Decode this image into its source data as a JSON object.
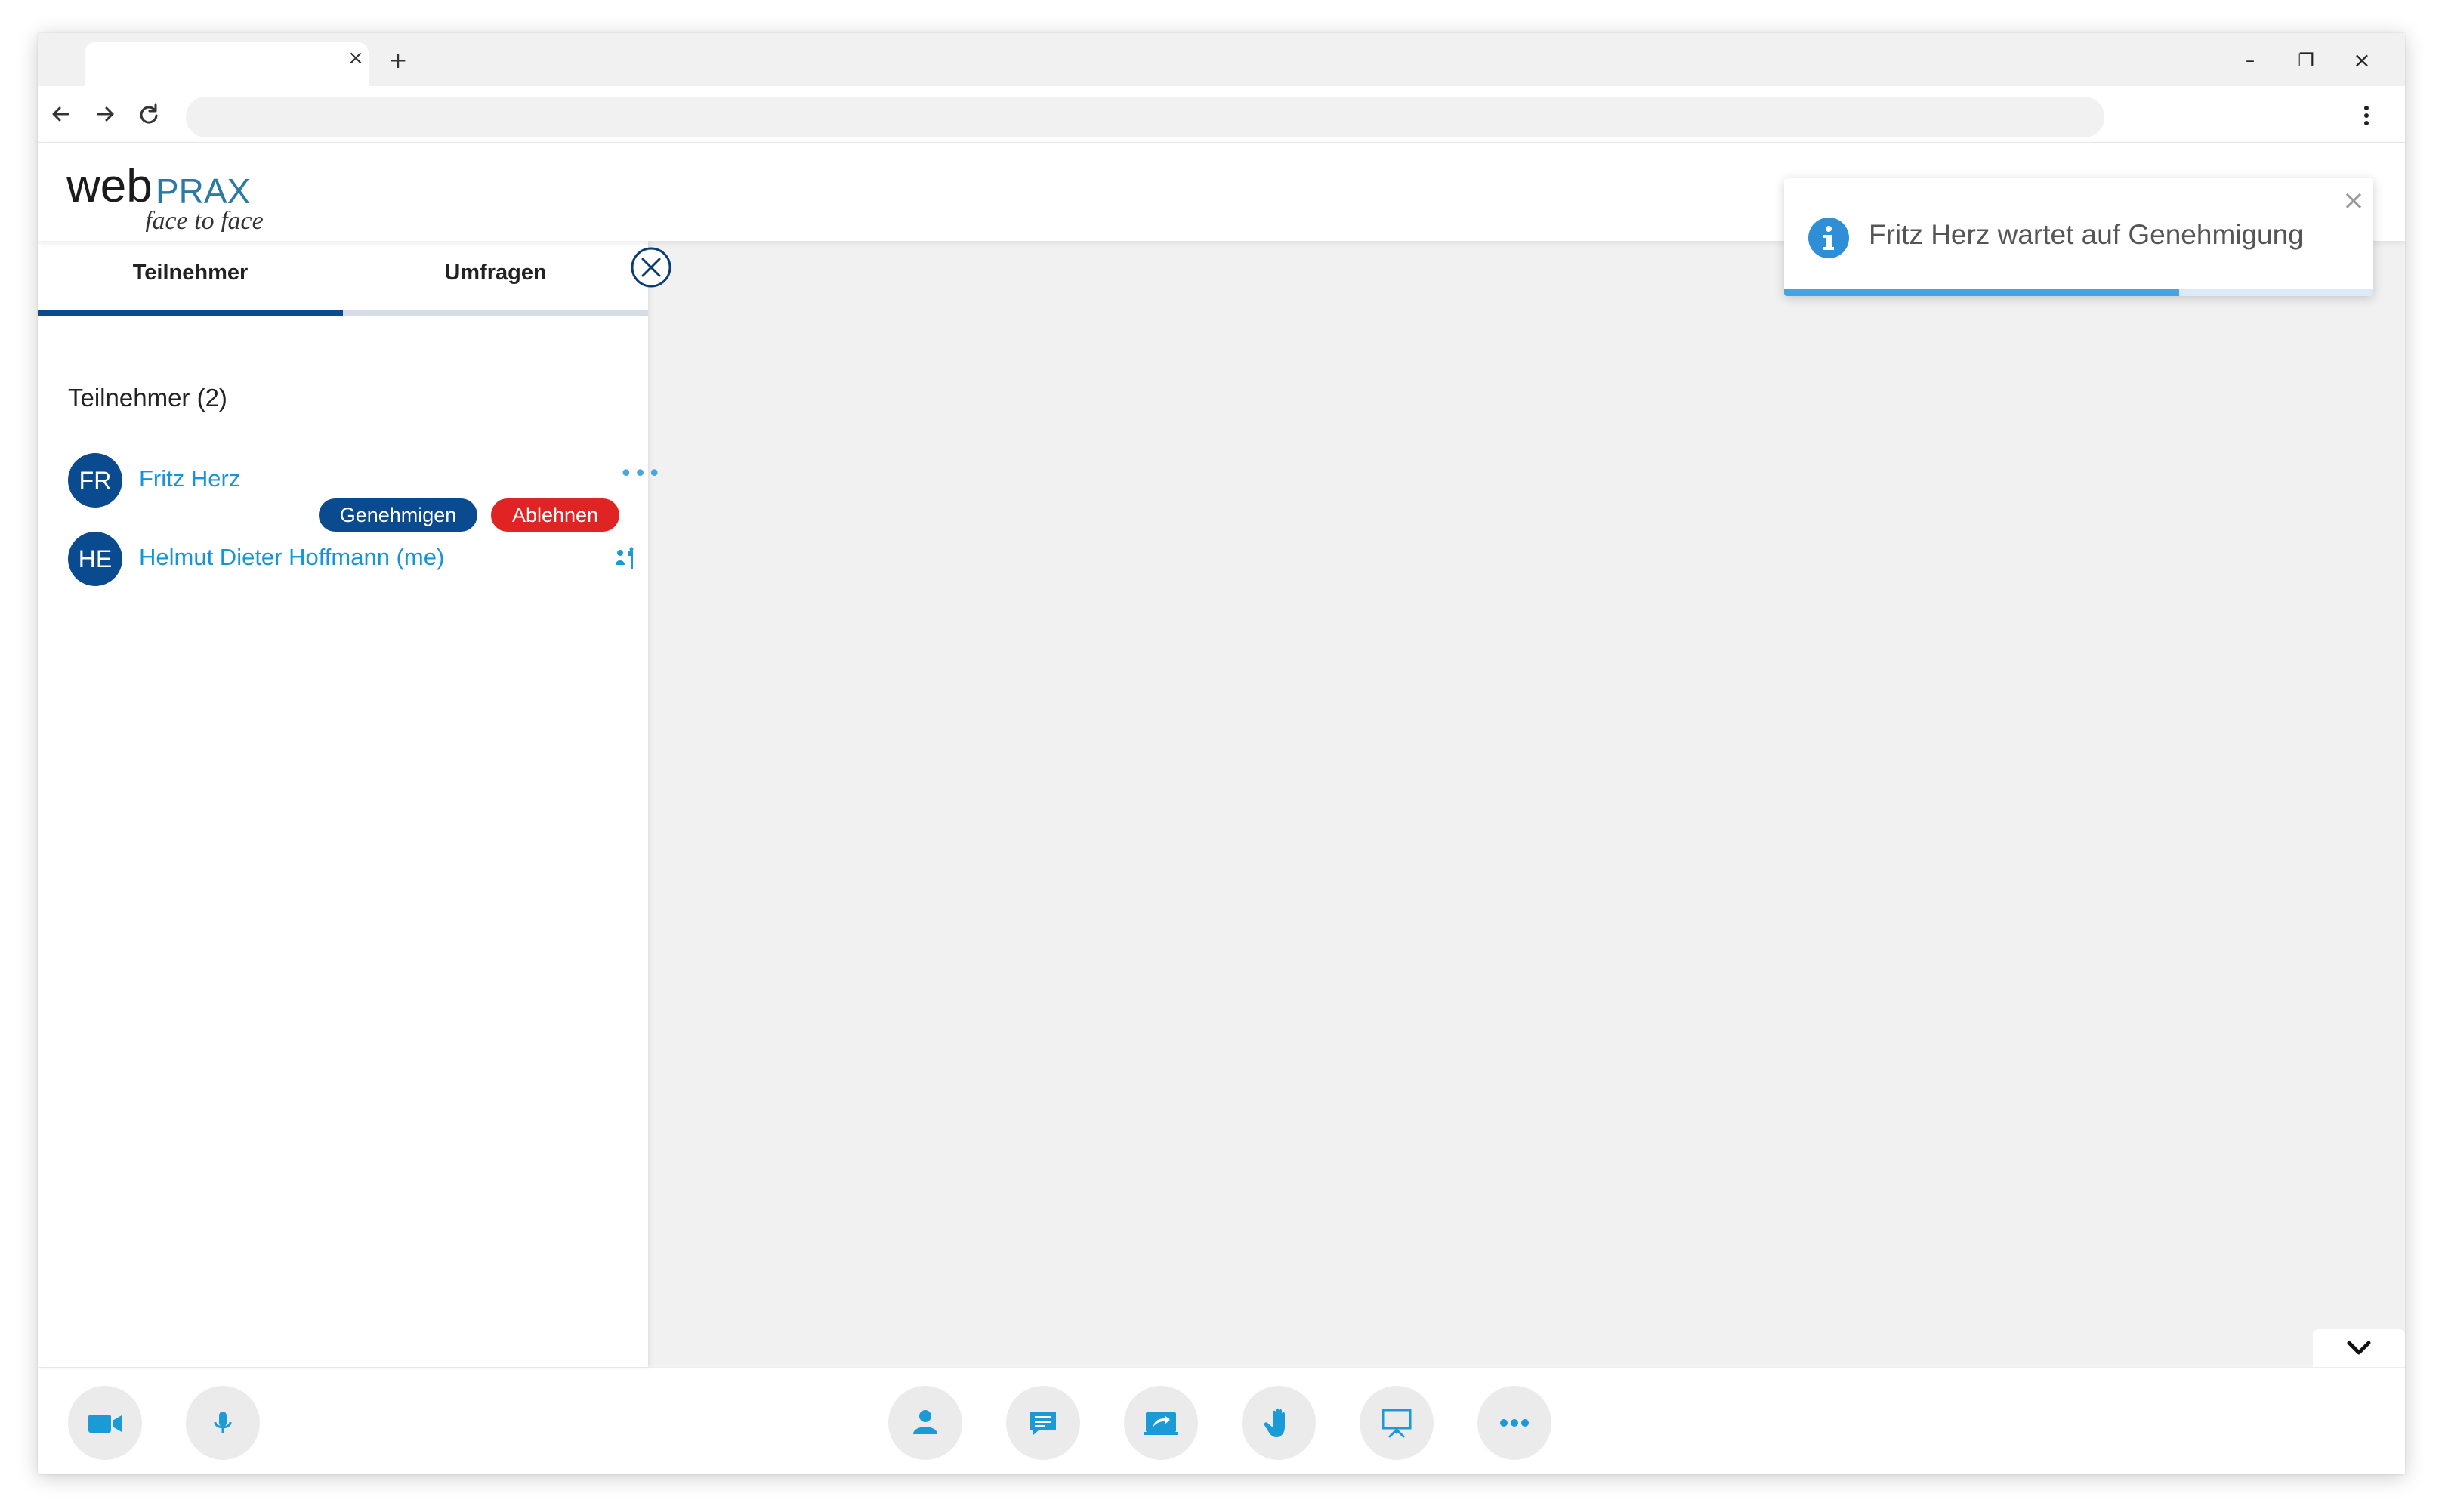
{
  "browser": {
    "tab_close": "×",
    "new_tab": "+",
    "window_controls": {
      "minimize": "–",
      "maximize": "❐",
      "close": "×"
    }
  },
  "app": {
    "logo": {
      "primary": "web",
      "secondary": "PRAX",
      "tagline": "face to face"
    },
    "colors": {
      "brand_dark": "#0a4a8e",
      "link_blue": "#1496d6",
      "reject_red": "#e02424",
      "icon_blue": "#1a9ad7"
    }
  },
  "sidepanel": {
    "tabs": [
      {
        "label": "Teilnehmer",
        "active": true
      },
      {
        "label": "Umfragen",
        "active": false
      }
    ],
    "list_title": "Teilnehmer (2)",
    "participants": [
      {
        "initials": "FR",
        "name": "Fritz Herz",
        "actions": {
          "approve": "Genehmigen",
          "reject": "Ablehnen"
        },
        "more": "•••"
      },
      {
        "initials": "HE",
        "name": "Helmut Dieter Hoffmann (me)",
        "icon": "host-icon"
      }
    ]
  },
  "toast": {
    "message": "Fritz Herz wartet auf Genehmigung",
    "icon": "info-icon",
    "close": "×",
    "progress": 0.67
  },
  "controls": {
    "left": [
      "camera-icon",
      "microphone-icon"
    ],
    "center": [
      "participants-icon",
      "chat-icon",
      "screen-share-icon",
      "raise-hand-icon",
      "whiteboard-icon",
      "more-icon"
    ]
  }
}
